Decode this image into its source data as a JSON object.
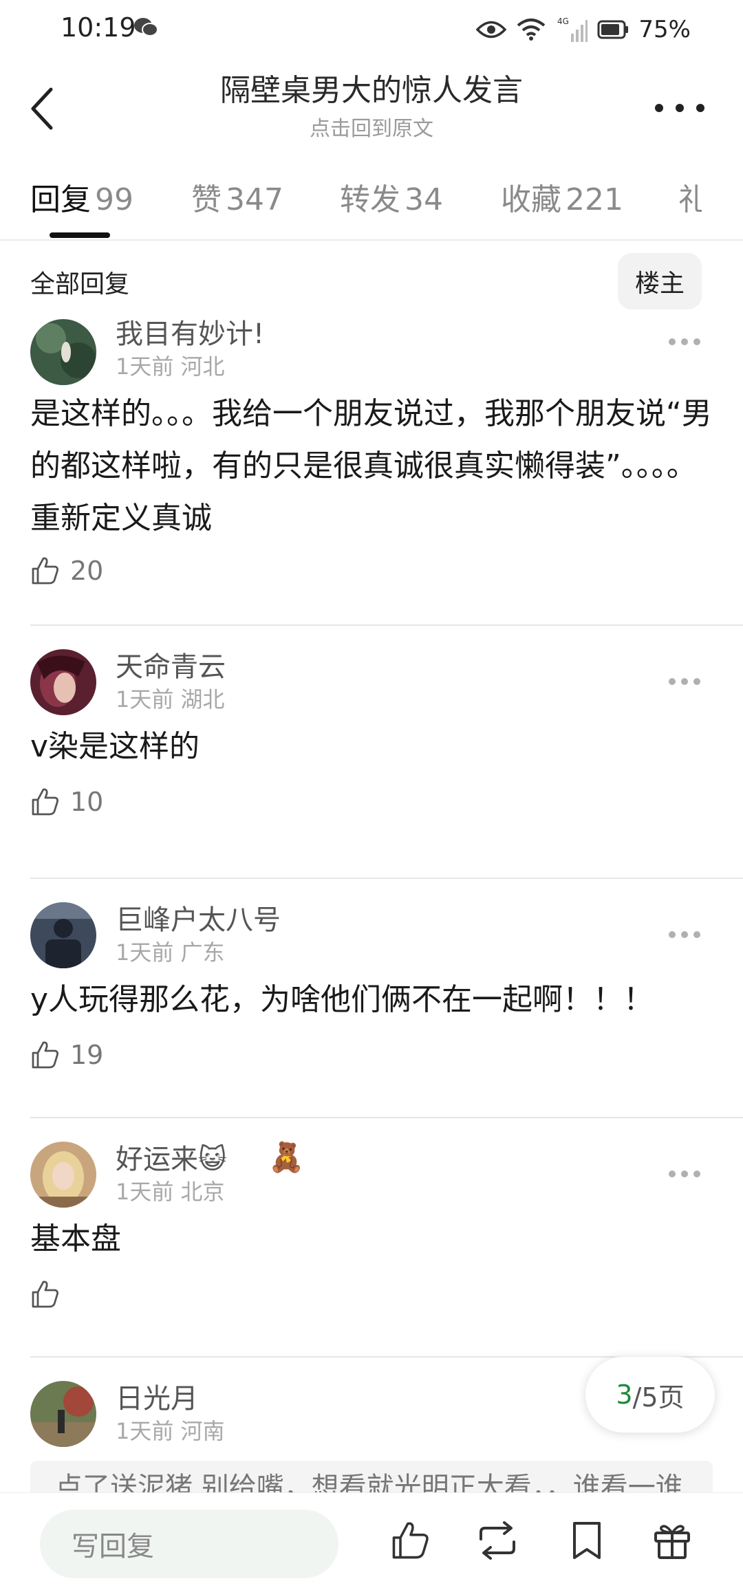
{
  "status_bar": {
    "time": "10:19",
    "network": "4G",
    "battery": "75%",
    "icons": [
      "wechat-icon",
      "eye-icon",
      "wifi-icon",
      "signal-icon",
      "battery-icon"
    ]
  },
  "header": {
    "title": "隔壁桌男大的惊人发言",
    "subtitle": "点击回到原文"
  },
  "tabs": [
    {
      "label": "回复",
      "count": "99",
      "active": true
    },
    {
      "label": "赞",
      "count": "347",
      "active": false
    },
    {
      "label": "转发",
      "count": "34",
      "active": false
    },
    {
      "label": "收藏",
      "count": "221",
      "active": false
    },
    {
      "label": "礼",
      "count": "",
      "active": false
    }
  ],
  "filter": {
    "label": "全部回复",
    "owner_button": "楼主"
  },
  "comments": [
    {
      "username": "我目有妙计!",
      "time": "1天前",
      "location": "河北",
      "text": "是这样的。。。我给一个朋友说过，我那个朋友说“男的都这样啦，有的只是很真诚很真实懒得装”。。。。重新定义真诚",
      "likes": "20",
      "avatar_color": "#3c5a44"
    },
    {
      "username": "天命青云",
      "time": "1天前",
      "location": "湖北",
      "text": "v染是这样的",
      "likes": "10",
      "avatar_color": "#5a2030"
    },
    {
      "username": "巨峰户太八号",
      "time": "1天前",
      "location": "广东",
      "text": "y人玩得那么花，为啥他们俩不在一起啊！！！",
      "likes": "19",
      "avatar_color": "#3e4a5c"
    },
    {
      "username": "好运来😺",
      "badge": "🧸",
      "time": "1天前",
      "location": "北京",
      "text": "基本盘",
      "likes": "",
      "avatar_color": "#c9a57e"
    },
    {
      "username": "日光月",
      "time": "1天前",
      "location": "河南",
      "text": "",
      "likes": "",
      "avatar_color": "#6b7a50"
    }
  ],
  "quote_preview": "点了送泥猪 别给嘴，想看就光明正大看，，谁看一谁",
  "pagination": {
    "current": "3",
    "total": "/5页"
  },
  "bottom_bar": {
    "reply_placeholder": "写回复",
    "actions": [
      "like-icon",
      "repost-icon",
      "bookmark-icon",
      "gift-icon"
    ]
  }
}
